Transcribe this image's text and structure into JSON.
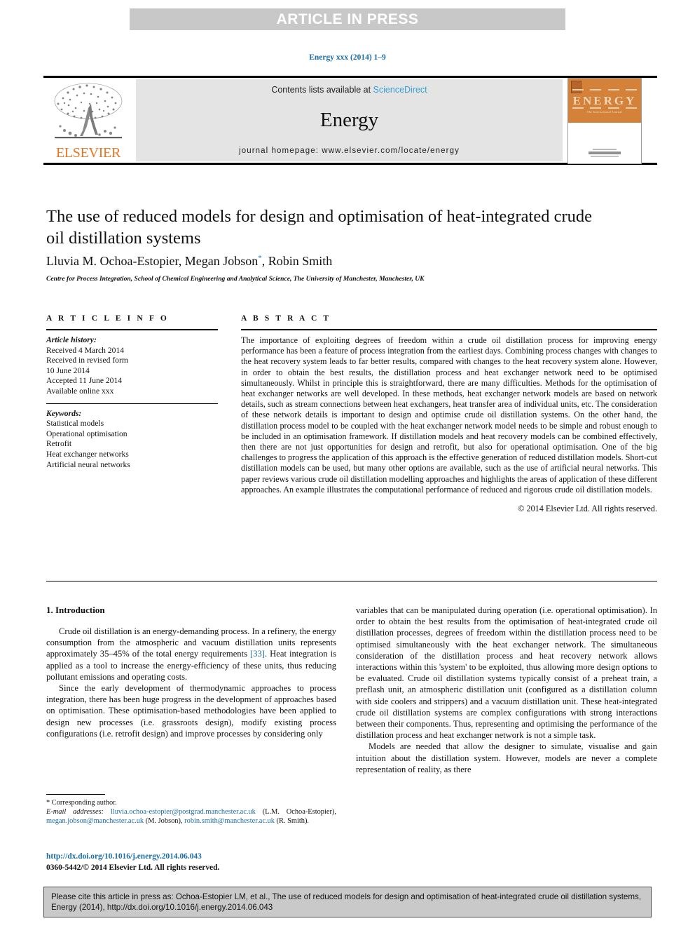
{
  "banner": {
    "text": "ARTICLE IN PRESS"
  },
  "journal_ref": "Energy xxx (2014) 1–9",
  "masthead": {
    "contents_prefix": "Contents lists available at ",
    "sciencedirect": "ScienceDirect",
    "journal_name": "Energy",
    "homepage": "journal homepage: www.elsevier.com/locate/energy",
    "publisher": "ELSEVIER",
    "cover": {
      "title": "ENERGY",
      "subtitle": "The International Journal"
    }
  },
  "article": {
    "title": "The use of reduced models for design and optimisation of heat-integrated crude oil distillation systems",
    "authors_part1": "Lluvia M. Ochoa-Estopier, Megan Jobson",
    "authors_star": "*",
    "authors_part2": ", Robin Smith",
    "affiliation": "Centre for Process Integration, School of Chemical Engineering and Analytical Science, The University of Manchester, Manchester, UK"
  },
  "info": {
    "heading": "A R T I C L E   I N F O",
    "history_label": "Article history:",
    "history": [
      "Received 4 March 2014",
      "Received in revised form",
      "10 June 2014",
      "Accepted 11 June 2014",
      "Available online xxx"
    ],
    "keywords_label": "Keywords:",
    "keywords": [
      "Statistical models",
      "Operational optimisation",
      "Retrofit",
      "Heat exchanger networks",
      "Artificial neural networks"
    ]
  },
  "abstract": {
    "heading": "A B S T R A C T",
    "text": "The importance of exploiting degrees of freedom within a crude oil distillation process for improving energy performance has been a feature of process integration from the earliest days. Combining process changes with changes to the heat recovery system leads to far better results, compared with changes to the heat recovery system alone. However, in order to obtain the best results, the distillation process and heat exchanger network need to be optimised simultaneously. Whilst in principle this is straightforward, there are many difficulties. Methods for the optimisation of heat exchanger networks are well developed. In these methods, heat exchanger network models are based on network details, such as stream connections between heat exchangers, heat transfer area of individual units, etc. The consideration of these network details is important to design and optimise crude oil distillation systems. On the other hand, the distillation process model to be coupled with the heat exchanger network model needs to be simple and robust enough to be included in an optimisation framework. If distillation models and heat recovery models can be combined effectively, then there are not just opportunities for design and retrofit, but also for operational optimisation. One of the big challenges to progress the application of this approach is the effective generation of reduced distillation models. Short-cut distillation models can be used, but many other options are available, such as the use of artificial neural networks. This paper reviews various crude oil distillation modelling approaches and highlights the areas of application of these different approaches. An example illustrates the computational performance of reduced and rigorous crude oil distillation models.",
    "copyright": "© 2014 Elsevier Ltd. All rights reserved."
  },
  "body": {
    "section_title": "1. Introduction",
    "left_para1_a": "Crude oil distillation is an energy-demanding process. In a refinery, the energy consumption from the atmospheric and vacuum distillation units represents approximately 35–45% of the total energy requirements ",
    "left_para1_ref": "[33]",
    "left_para1_b": ". Heat integration is applied as a tool to increase the energy-efficiency of these units, thus reducing pollutant emissions and operating costs.",
    "left_para2": "Since the early development of thermodynamic approaches to process integration, there has been huge progress in the development of approaches based on optimisation. These optimisation-based methodologies have been applied to design new processes (i.e. grassroots design), modify existing process configurations (i.e. retrofit design) and improve processes by considering only",
    "right_para1": "variables that can be manipulated during operation (i.e. operational optimisation). In order to obtain the best results from the optimisation of heat-integrated crude oil distillation processes, degrees of freedom within the distillation process need to be optimised simultaneously with the heat exchanger network. The simultaneous consideration of the distillation process and heat recovery network allows interactions within this 'system' to be exploited, thus allowing more design options to be evaluated. Crude oil distillation systems typically consist of a preheat train, a preflash unit, an atmospheric distillation unit (configured as a distillation column with side coolers and strippers) and a vacuum distillation unit. These heat-integrated crude oil distillation systems are complex configurations with strong interactions between their components. Thus, representing and optimising the performance of the distillation process and heat exchanger network is not a simple task.",
    "right_para2": "Models are needed that allow the designer to simulate, visualise and gain intuition about the distillation system. However, models are never a complete representation of reality, as there"
  },
  "footnote": {
    "corresponding": "* Corresponding author.",
    "email_label": "E-mail addresses:",
    "email1": "lluvia.ochoa-estopier@postgrad.manchester.ac.uk",
    "name1": "(L.M. Ochoa-Estopier),",
    "email2": "megan.jobson@manchester.ac.uk",
    "name2": "(M. Jobson),",
    "email3": "robin.smith@manchester.ac.uk",
    "name3": "(R. Smith)."
  },
  "doi": "http://dx.doi.org/10.1016/j.energy.2014.06.043",
  "issn": "0360-5442/© 2014 Elsevier Ltd. All rights reserved.",
  "citation_box": {
    "text": "Please cite this article in press as: Ochoa-Estopier LM, et al., The use of reduced models for design and optimisation of heat-integrated crude oil distillation systems, Energy (2014), http://dx.doi.org/10.1016/j.energy.2014.06.043"
  },
  "colors": {
    "link": "#1a6ca8",
    "sciencedirect": "#3b9fd6",
    "elsevier_orange": "#e87722",
    "banner_bg": "#c8c8c8",
    "masthead_grey": "#e4e4e4",
    "cite_box_bg": "#c9c9c9"
  }
}
